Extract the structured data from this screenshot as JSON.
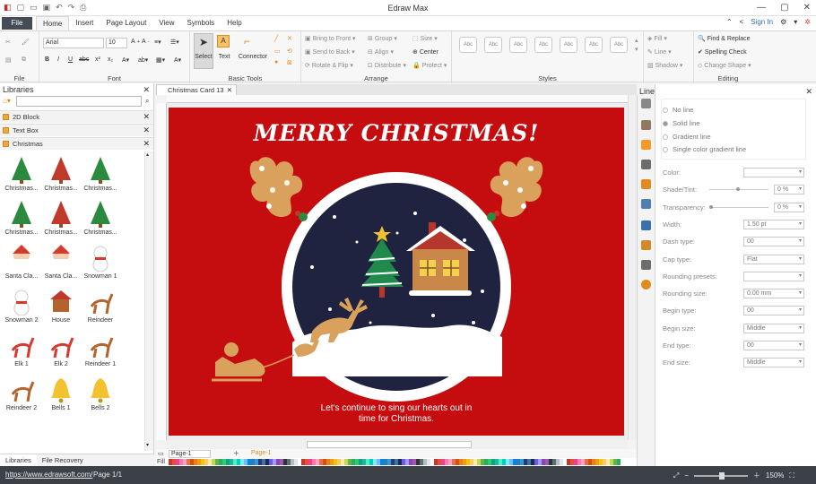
{
  "window": {
    "title": "Edraw Max"
  },
  "menubar": {
    "file": "File",
    "items": [
      "Home",
      "Insert",
      "Page Layout",
      "View",
      "Symbols",
      "Help"
    ],
    "active": "Home",
    "sign_in": "Sign In"
  },
  "ribbon": {
    "font_name": "Arial",
    "font_size": "10",
    "groups": {
      "file": "File",
      "font": "Font",
      "basic_tools": "Basic Tools",
      "arrange": "Arrange",
      "styles": "Styles",
      "editing": "Editing"
    },
    "basic_tools": {
      "select": "Select",
      "text": "Text",
      "connector": "Connector"
    },
    "arrange": {
      "bring_front": "Bring to Front",
      "send_back": "Send to Back",
      "rotate_flip": "Rotate & Flip",
      "group": "Group",
      "align": "Align",
      "distribute": "Distribute",
      "size": "Size",
      "center": "Center",
      "protect": "Protect"
    },
    "style_box_label": "Abc",
    "fill": "Fill",
    "line": "Line",
    "shadow": "Shadow",
    "editing": {
      "find_replace": "Find & Replace",
      "spelling": "Spelling Check",
      "change_shape": "Change Shape"
    }
  },
  "libraries": {
    "title": "Libraries",
    "categories": [
      "2D Block",
      "Text Box",
      "Christmas"
    ],
    "items": [
      "Christmas...",
      "Christmas...",
      "Christmas...",
      "Christmas...",
      "Christmas...",
      "Christmas...",
      "Santa Cla...",
      "Santa Cla...",
      "Snowman 1",
      "Snowman 2",
      "House",
      "Reindeer",
      "Elk 1",
      "Elk 2",
      "Reindeer 1",
      "Reindeer 2",
      "Bells 1",
      "Bells 2"
    ],
    "tabs": [
      "Libraries",
      "File Recovery"
    ]
  },
  "document": {
    "tab": "Christmas Card 13",
    "page_tab": "Page-1",
    "page_label": "Page-1",
    "fill_label": "Fill"
  },
  "card": {
    "headline": "MERRY CHRISTMAS!",
    "message_line1": "Let's continue to sing our hearts out in",
    "message_line2": "time for Christmas."
  },
  "line_panel": {
    "title": "Line",
    "options": [
      "No line",
      "Solid line",
      "Gradient line",
      "Single color gradient line"
    ],
    "selected": "Solid line",
    "properties": [
      {
        "label": "Color:",
        "value": ""
      },
      {
        "label": "Shade/Tint:",
        "value": "0 %"
      },
      {
        "label": "Transparency:",
        "value": "0 %"
      },
      {
        "label": "Width:",
        "value": "1.50 pt"
      },
      {
        "label": "Dash type:",
        "value": "00"
      },
      {
        "label": "Cap type:",
        "value": "Flat"
      },
      {
        "label": "Rounding presets:",
        "value": ""
      },
      {
        "label": "Rounding size:",
        "value": "0.00 mm"
      },
      {
        "label": "Begin type:",
        "value": "00"
      },
      {
        "label": "Begin size:",
        "value": "Middle"
      },
      {
        "label": "End type:",
        "value": "00"
      },
      {
        "label": "End size:",
        "value": "Middle"
      }
    ]
  },
  "status": {
    "url": "https://www.edrawsoft.com/",
    "page": "Page 1/1",
    "zoom": "150%"
  },
  "colors": {
    "card_red": "#c50c0e",
    "night_navy": "#1f2340",
    "antler_tan": "#d9a15b",
    "status_bg": "#3c4148"
  }
}
